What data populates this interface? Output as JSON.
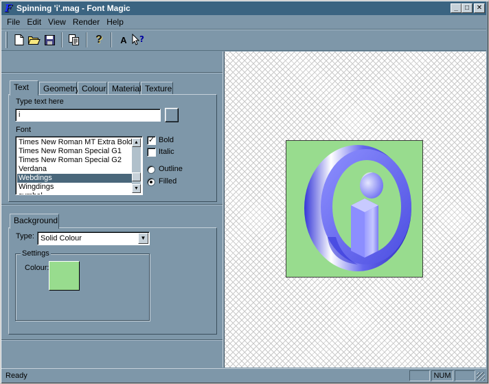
{
  "window": {
    "title": "Spinning 'i'.mag - Font Magic"
  },
  "title_buttons": {
    "minimize": "_",
    "maximize": "□",
    "close": "✕"
  },
  "menu": [
    "File",
    "Edit",
    "View",
    "Render",
    "Help"
  ],
  "toolbar": {
    "icons": [
      "new-file-icon",
      "open-folder-icon",
      "save-icon",
      "copy-icon",
      "help-icon",
      "font-icon",
      "context-help-icon"
    ],
    "glyphs": {
      "new": "🗋",
      "open": "📂",
      "save": "💾",
      "copy": "📋",
      "help": "?",
      "font": "A",
      "context_help": "?"
    }
  },
  "text_panel": {
    "tabs": [
      "Text",
      "Geometry",
      "Colour",
      "Material",
      "Texture"
    ],
    "active_tab": "Text",
    "type_text_label": "Type text here",
    "text_value": "i",
    "font_label": "Font",
    "fonts": [
      "Times New Roman MT Extra Bold",
      "Times New Roman Special G1",
      "Times New Roman Special G2",
      "Verdana",
      "Webdings",
      "Wingdings",
      "symbol"
    ],
    "selected_font": "Webdings",
    "bold_label": "Bold",
    "bold_checked": true,
    "italic_label": "Italic",
    "italic_checked": false,
    "outline_label": "Outline",
    "filled_label": "Filled",
    "style_mode": "Filled"
  },
  "background_panel": {
    "tab": "Background",
    "type_label": "Type:",
    "type_value": "Solid Colour",
    "settings_label": "Settings",
    "colour_label": "Colour:",
    "colour_value": "#98dc8e"
  },
  "render": {
    "background": "#98dc8e",
    "glyph_color": "#6a6cf0"
  },
  "status": {
    "text": "Ready",
    "num": "NUM"
  },
  "colors": {
    "chrome": "#7e97a9",
    "titlebar": "#3b6481",
    "selection": "#4a677b"
  }
}
